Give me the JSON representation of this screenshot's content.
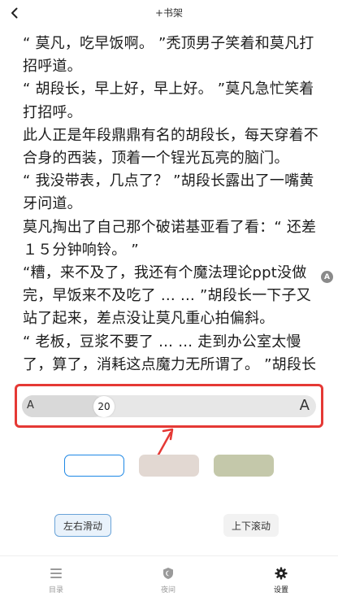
{
  "topbar": {
    "back_icon": "chevron-left-icon",
    "shelf_label": "+书架"
  },
  "reader": {
    "paragraphs": [
      "“ 莫凡，吃早饭啊。 ”秃顶男子笑着和莫凡打招呼道。",
      "“ 胡段长，早上好，早上好。 ”莫凡急忙笑着打招呼。",
      "此人正是年段鼎鼎有名的胡段长，每天穿着不合身的西装，顶着一个锃光瓦亮的脑门。",
      "“ 我没带表，几点了？ ”胡段长露出了一嘴黄牙问道。",
      "莫凡掏出了自己那个破诺基亚看了看：“ 还差１５分钟响铃。 ”",
      "“糟，来不及了，我还有个魔法理论ppt没做完，早饭来不及吃了 … … ”胡段长一下子又站了起来，差点没让莫凡重心拍偏斜。",
      "“ 老板，豆浆不要了 … … 走到办公室太慢了，算了，消耗这点魔力无所谓了。 ”胡段长"
    ],
    "badge": "A"
  },
  "font_size": {
    "small_label": "A",
    "large_label": "A",
    "value": "20",
    "fraction": 0.28
  },
  "themes": [
    {
      "name": "white",
      "color": "#ffffff",
      "selected": true
    },
    {
      "name": "beige",
      "color": "#e2d8d2",
      "selected": false
    },
    {
      "name": "green",
      "color": "#c4c8aa",
      "selected": false
    }
  ],
  "page_modes": {
    "horizontal": "左右滑动",
    "vertical": "上下滚动"
  },
  "bottom_nav": {
    "catalog": "目录",
    "night": "夜间",
    "settings": "设置"
  },
  "colors": {
    "accent": "#1e88e5",
    "highlight_box": "#e53935"
  }
}
